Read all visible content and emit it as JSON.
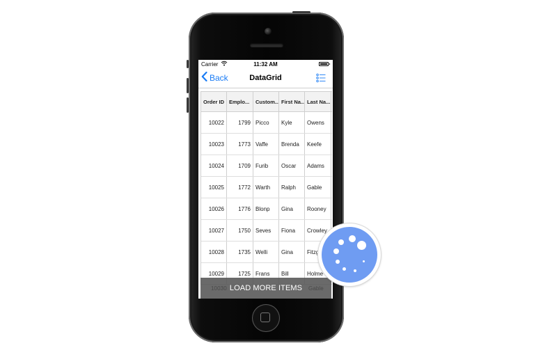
{
  "status_bar": {
    "carrier": "Carrier",
    "time": "11:32 AM"
  },
  "nav": {
    "back_label": "Back",
    "title": "DataGrid",
    "right_icon": "list-icon"
  },
  "grid": {
    "columns": [
      "Order ID",
      "Emplo...",
      "Custom...",
      "First Na...",
      "Last Na..."
    ],
    "rows": [
      [
        "10022",
        "1799",
        "Picco",
        "Kyle",
        "Owens"
      ],
      [
        "10023",
        "1773",
        "Vaffe",
        "Brenda",
        "Keefe"
      ],
      [
        "10024",
        "1709",
        "Furib",
        "Oscar",
        "Adams"
      ],
      [
        "10025",
        "1772",
        "Warth",
        "Ralph",
        "Gable"
      ],
      [
        "10026",
        "1776",
        "Blonp",
        "Gina",
        "Rooney"
      ],
      [
        "10027",
        "1750",
        "Seves",
        "Fiona",
        "Crowley"
      ],
      [
        "10028",
        "1735",
        "Welli",
        "Gina",
        "Fitzge"
      ],
      [
        "10029",
        "1725",
        "Frans",
        "Bill",
        "Holme"
      ]
    ]
  },
  "load_more": {
    "label": "LOAD MORE ITEMS",
    "ghost_order_id": "10030",
    "ghost_last_name": "Gable"
  },
  "colors": {
    "accent": "#1a7cf5",
    "badge": "#6f9cf2",
    "overlay": "#555555"
  }
}
